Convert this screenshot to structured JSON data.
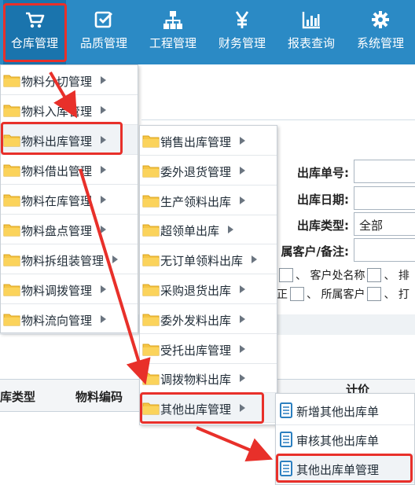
{
  "nav": {
    "items": [
      {
        "label": "仓库管理",
        "icon": "cart-icon"
      },
      {
        "label": "品质管理",
        "icon": "checkbox-icon"
      },
      {
        "label": "工程管理",
        "icon": "org-chart-icon"
      },
      {
        "label": "财务管理",
        "icon": "yen-icon"
      },
      {
        "label": "报表查询",
        "icon": "bar-chart-icon"
      },
      {
        "label": "系统管理",
        "icon": "gear-icon"
      }
    ],
    "active_index": 0
  },
  "menu1": {
    "items": [
      {
        "label": "物料分切管理"
      },
      {
        "label": "物料入库管理"
      },
      {
        "label": "物料出库管理"
      },
      {
        "label": "物料借出管理"
      },
      {
        "label": "物料在库管理"
      },
      {
        "label": "物料盘点管理"
      },
      {
        "label": "物料拆组装管理"
      },
      {
        "label": "物料调拨管理"
      },
      {
        "label": "物料流向管理"
      }
    ]
  },
  "menu2": {
    "items": [
      {
        "label": "销售出库管理"
      },
      {
        "label": "委外退货管理"
      },
      {
        "label": "生产领料出库"
      },
      {
        "label": "超领单出库"
      },
      {
        "label": "无订单领料出库"
      },
      {
        "label": "采购退货出库"
      },
      {
        "label": "委外发料出库"
      },
      {
        "label": "受托出库管理"
      },
      {
        "label": "调拨物料出库"
      },
      {
        "label": "其他出库管理"
      }
    ]
  },
  "menu3": {
    "items": [
      {
        "label": "新增其他出库单"
      },
      {
        "label": "审核其他出库单"
      },
      {
        "label": "其他出库单管理"
      }
    ]
  },
  "form": {
    "order_no_label": "出库单号:",
    "order_date_label": "出库日期:",
    "type_label": "出库类型:",
    "type_value": "全部",
    "customer_label": "属客户/备注:",
    "chk_line1_a": "、 客户处名称",
    "chk_line1_b": "、 排",
    "chk_line2_a": "正",
    "chk_line2_b": "、 所属客户",
    "chk_line2_c": "、 打"
  },
  "table": {
    "col_type": "库类型",
    "col_code": "物料编码",
    "col_price": "计价"
  },
  "colors": {
    "nav_bg": "#2b8ac5",
    "highlight_red": "#e8302a",
    "folder_yellow": "#f6c545"
  }
}
